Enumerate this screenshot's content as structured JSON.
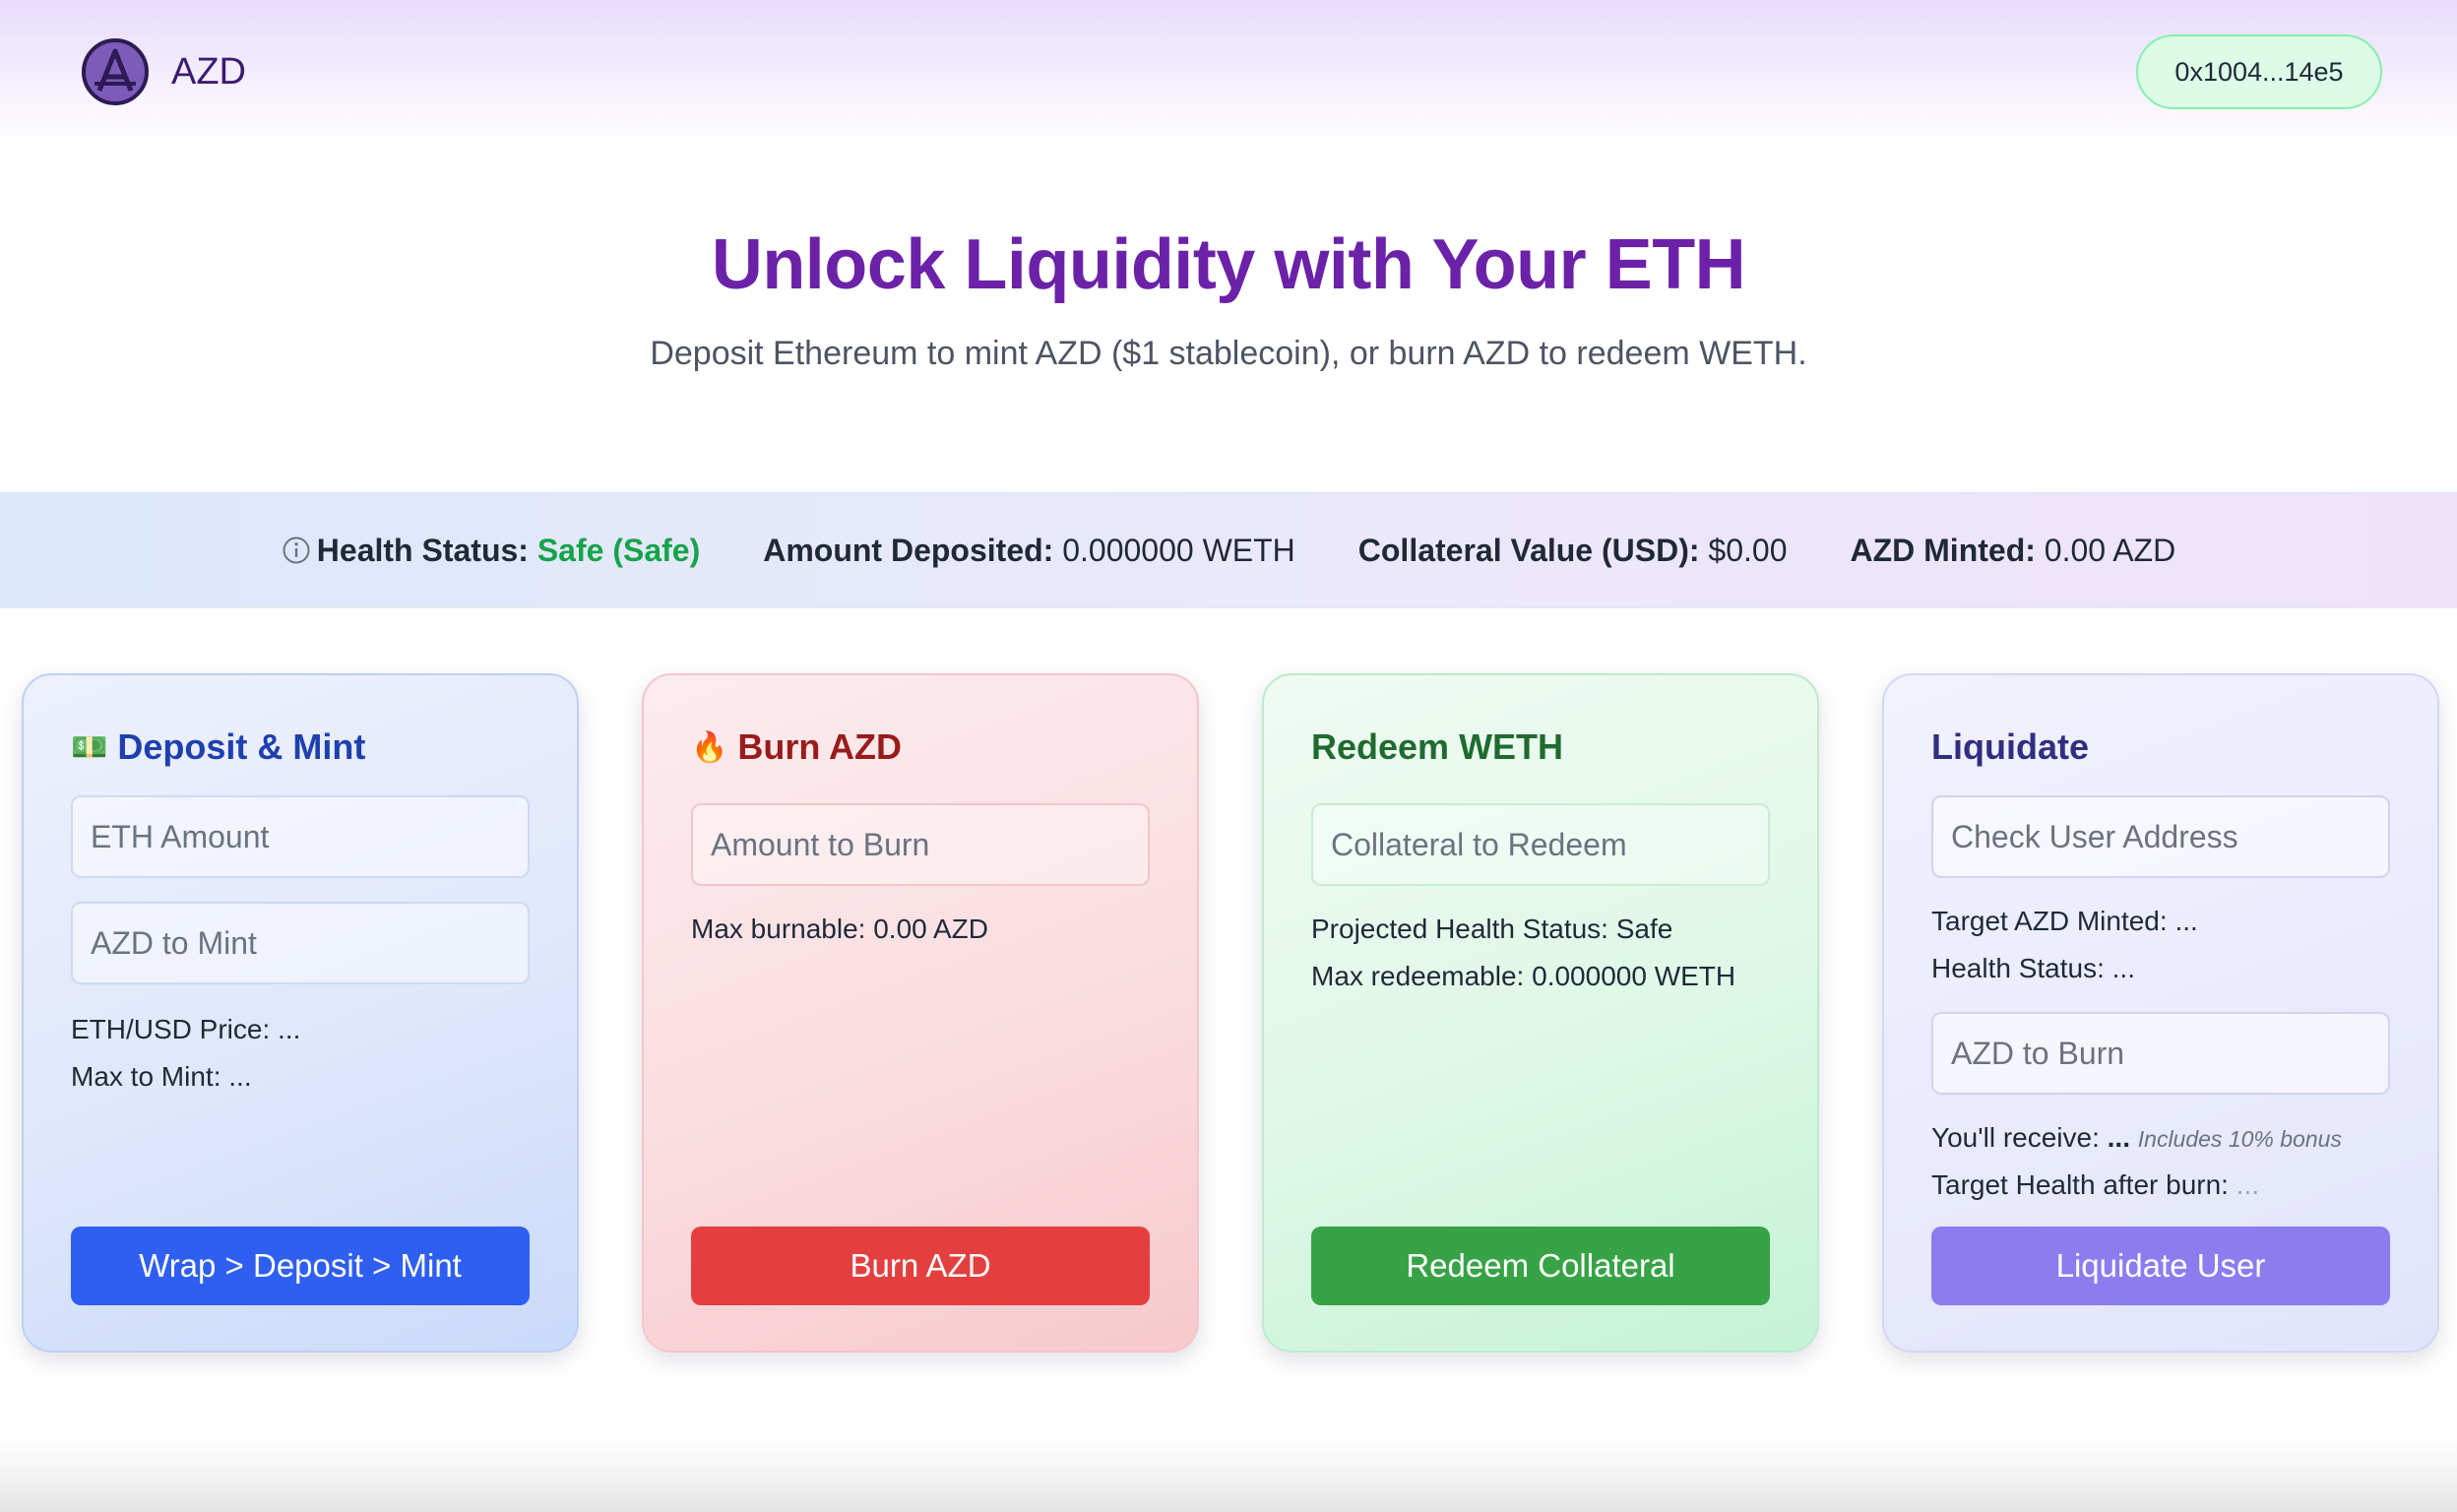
{
  "app": {
    "name": "AZD"
  },
  "header": {
    "wallet_address": "0x1004...14e5"
  },
  "hero": {
    "title": "Unlock Liquidity with Your ETH",
    "subtitle": "Deposit Ethereum to mint AZD ($1 stablecoin), or burn AZD to redeem WETH."
  },
  "status": {
    "health_label": "Health Status:",
    "health_value": "Safe (Safe)",
    "deposited_label": "Amount Deposited:",
    "deposited_value": "0.000000 WETH",
    "collateral_label": "Collateral Value (USD):",
    "collateral_value": "$0.00",
    "minted_label": "AZD Minted:",
    "minted_value": "0.00 AZD"
  },
  "deposit_card": {
    "emoji": "💵",
    "title": "Deposit & Mint",
    "eth_placeholder": "ETH Amount",
    "azd_placeholder": "AZD to Mint",
    "price_label": "ETH/USD Price:",
    "price_value": "...",
    "max_label": "Max to Mint:",
    "max_value": "...",
    "button": "Wrap > Deposit > Mint"
  },
  "burn_card": {
    "emoji": "🔥",
    "title": "Burn AZD",
    "amount_placeholder": "Amount to Burn",
    "max_label": "Max burnable:",
    "max_value": "0.00 AZD",
    "button": "Burn AZD"
  },
  "redeem_card": {
    "title": "Redeem WETH",
    "collateral_placeholder": "Collateral to Redeem",
    "projected_label": "Projected Health Status:",
    "projected_value": "Safe",
    "max_label": "Max redeemable:",
    "max_value": "0.000000 WETH",
    "button": "Redeem Collateral"
  },
  "liquidate_card": {
    "title": "Liquidate",
    "address_placeholder": "Check User Address",
    "target_minted_label": "Target AZD Minted:",
    "target_minted_value": "...",
    "health_label": "Health Status:",
    "health_value": "...",
    "burn_placeholder": "AZD to Burn",
    "receive_label": "You'll receive:",
    "receive_value": "...",
    "bonus_note": "Includes 10% bonus",
    "target_health_label": "Target Health after burn:",
    "target_health_value": "...",
    "button": "Liquidate User"
  },
  "colors": {
    "brand_purple": "#6b21a8",
    "safe_green": "#16a34a",
    "deposit_button": "#2f5ff0",
    "burn_button": "#e43f3f",
    "redeem_button": "#37a346",
    "liquidate_button": "#8b7cf0"
  },
  "icons": {
    "logo": "azd-logo-icon",
    "info": "info-circle-icon"
  }
}
